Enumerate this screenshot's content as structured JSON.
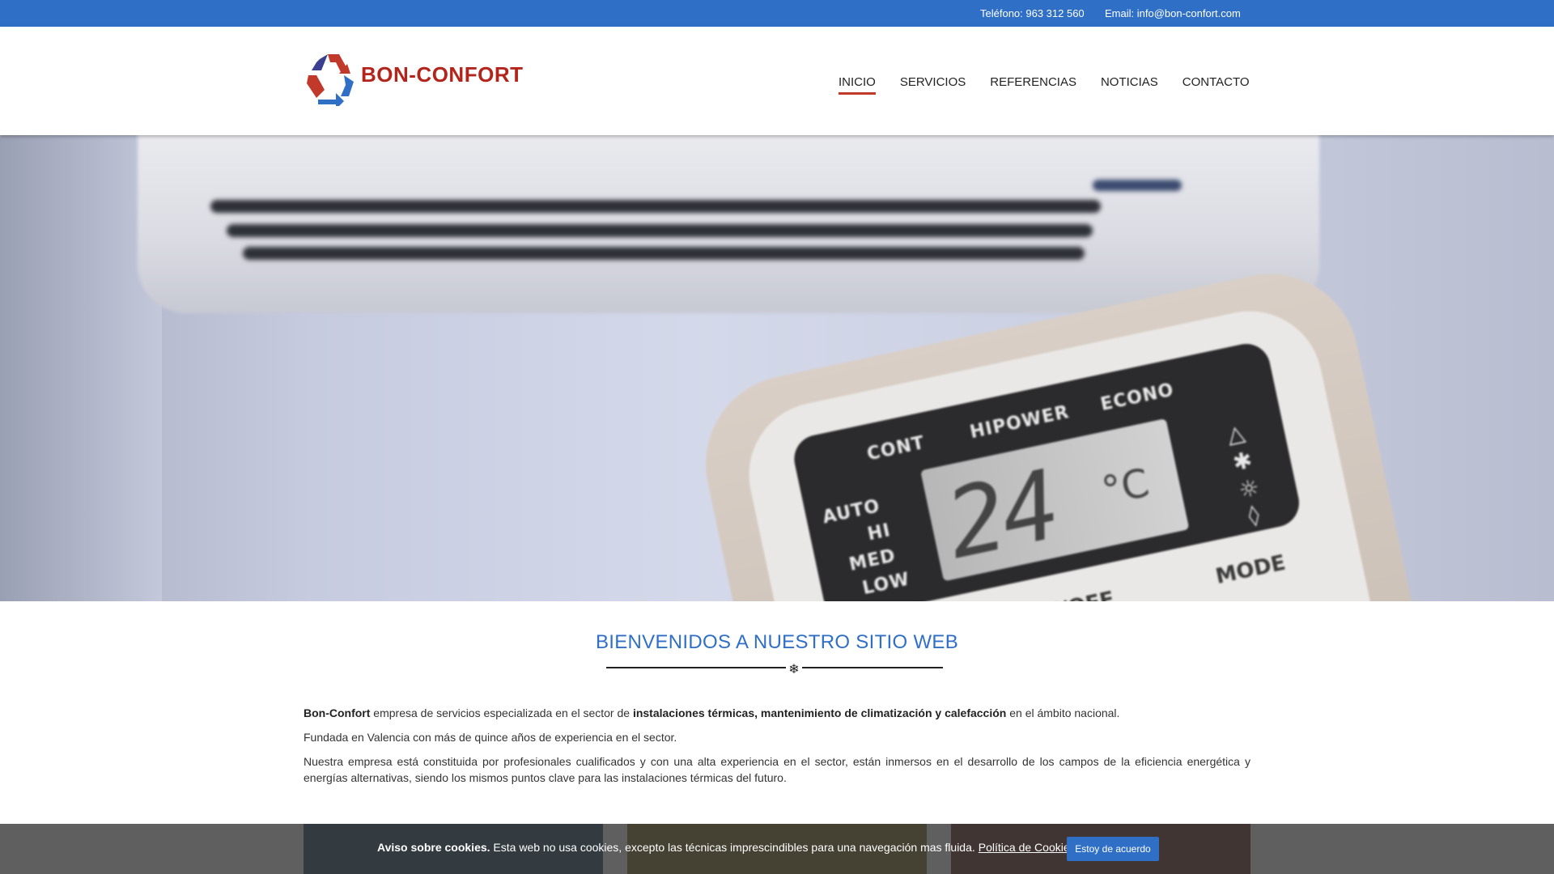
{
  "topbar": {
    "phone": "Teléfono: 963 312 560",
    "email": "Email: info@bon-confort.com"
  },
  "header": {
    "brand": "BON-CONFORT",
    "nav": [
      "INICIO",
      "SERVICIOS",
      "REFERENCIAS",
      "NOTICIAS",
      "CONTACTO"
    ],
    "active_nav": "INICIO"
  },
  "hero": {
    "remote_labels": {
      "cont": "CONT",
      "hipower": "HIPOWER",
      "econo": "ECONO",
      "auto": "AUTO",
      "hi": "HI",
      "med": "MED",
      "low": "LOW",
      "temp": "24",
      "unit": "°C",
      "onoff": "ON/OFF",
      "mode": "MODE"
    }
  },
  "welcome": {
    "title": "BIENVENIDOS A NUESTRO SITIO WEB",
    "divider_icon": "❄",
    "p1_brand": "Bon-Confort",
    "p1_mid": " empresa de servicios especializada en el sector de ",
    "p1_bold": "instalaciones térmicas, mantenimiento de climatización y calefacción",
    "p1_end": " en el ámbito nacional.",
    "p2": "Fundada en Valencia con más de quince años de experiencia en el sector.",
    "p3": "Nuestra empresa está constituida por profesionales cualificados y con una alta experiencia en el sector, están inmersos en el desarrollo de los campos de la eficiencia energética y energías alternativas, siendo los mismos puntos clave para las instalaciones térmicas del futuro."
  },
  "cookie": {
    "title": "Aviso sobre cookies.",
    "text": " Esta web no usa cookies, excepto las técnicas imprescindibles para una navegación mas fluida.",
    "link": "Política de Cookies",
    "button": "Estoy de acuerdo"
  },
  "colors": {
    "accent": "#2f6fc6",
    "brand_red": "#b3251b",
    "nav_underline": "#c0392b"
  }
}
